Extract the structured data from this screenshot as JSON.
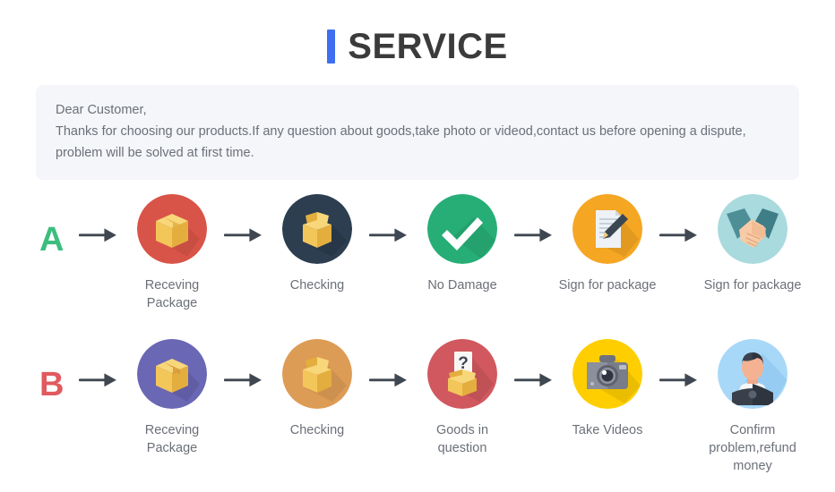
{
  "header": {
    "title": "SERVICE",
    "accent_color": "#3e6ff0",
    "title_color": "#3b3b3b"
  },
  "notice": {
    "greeting": "Dear Customer,",
    "line2": "Thanks for choosing our products.If any question about goods,take photo or videod,contact us before opening a dispute,",
    "line3": "problem will be solved at first time.",
    "background_color": "#f5f6fa",
    "text_color": "#6b7078"
  },
  "flows": [
    {
      "letter": "A",
      "letter_color": "#3dbd7d",
      "steps": [
        {
          "label": "Receving Package",
          "icon": "closed-box-icon",
          "disc_color": "#d95448"
        },
        {
          "label": "Checking",
          "icon": "open-box-icon",
          "disc_color": "#2c3e50"
        },
        {
          "label": "No Damage",
          "icon": "check-mark-icon",
          "disc_color": "#27ae76"
        },
        {
          "label": "Sign for package",
          "icon": "document-pen-icon",
          "disc_color": "#f5a623"
        },
        {
          "label": "Sign for package",
          "icon": "handshake-icon",
          "disc_color": "#a9dadd"
        }
      ]
    },
    {
      "letter": "B",
      "letter_color": "#e05a5f",
      "steps": [
        {
          "label": "Receving Package",
          "icon": "closed-box-icon",
          "disc_color": "#6a67b5"
        },
        {
          "label": "Checking",
          "icon": "open-box-icon",
          "disc_color": "#dd9c55"
        },
        {
          "label": "Goods in question",
          "icon": "box-question-icon",
          "disc_color": "#d1585f"
        },
        {
          "label": "Take Videos",
          "icon": "camera-icon",
          "disc_color": "#ffce00"
        },
        {
          "label": "Confirm  problem,refund money",
          "icon": "person-avatar-icon",
          "disc_color": "#a8d8f8"
        }
      ]
    }
  ],
  "arrow": {
    "name": "right-arrow-icon",
    "color": "#3f4750"
  },
  "palette": {
    "box_light": "#f8d77a",
    "box_mid": "#f3c65a",
    "box_dark": "#e4ae3f",
    "shadow": "rgba(0,0,0,0.10)",
    "white": "#ffffff"
  }
}
